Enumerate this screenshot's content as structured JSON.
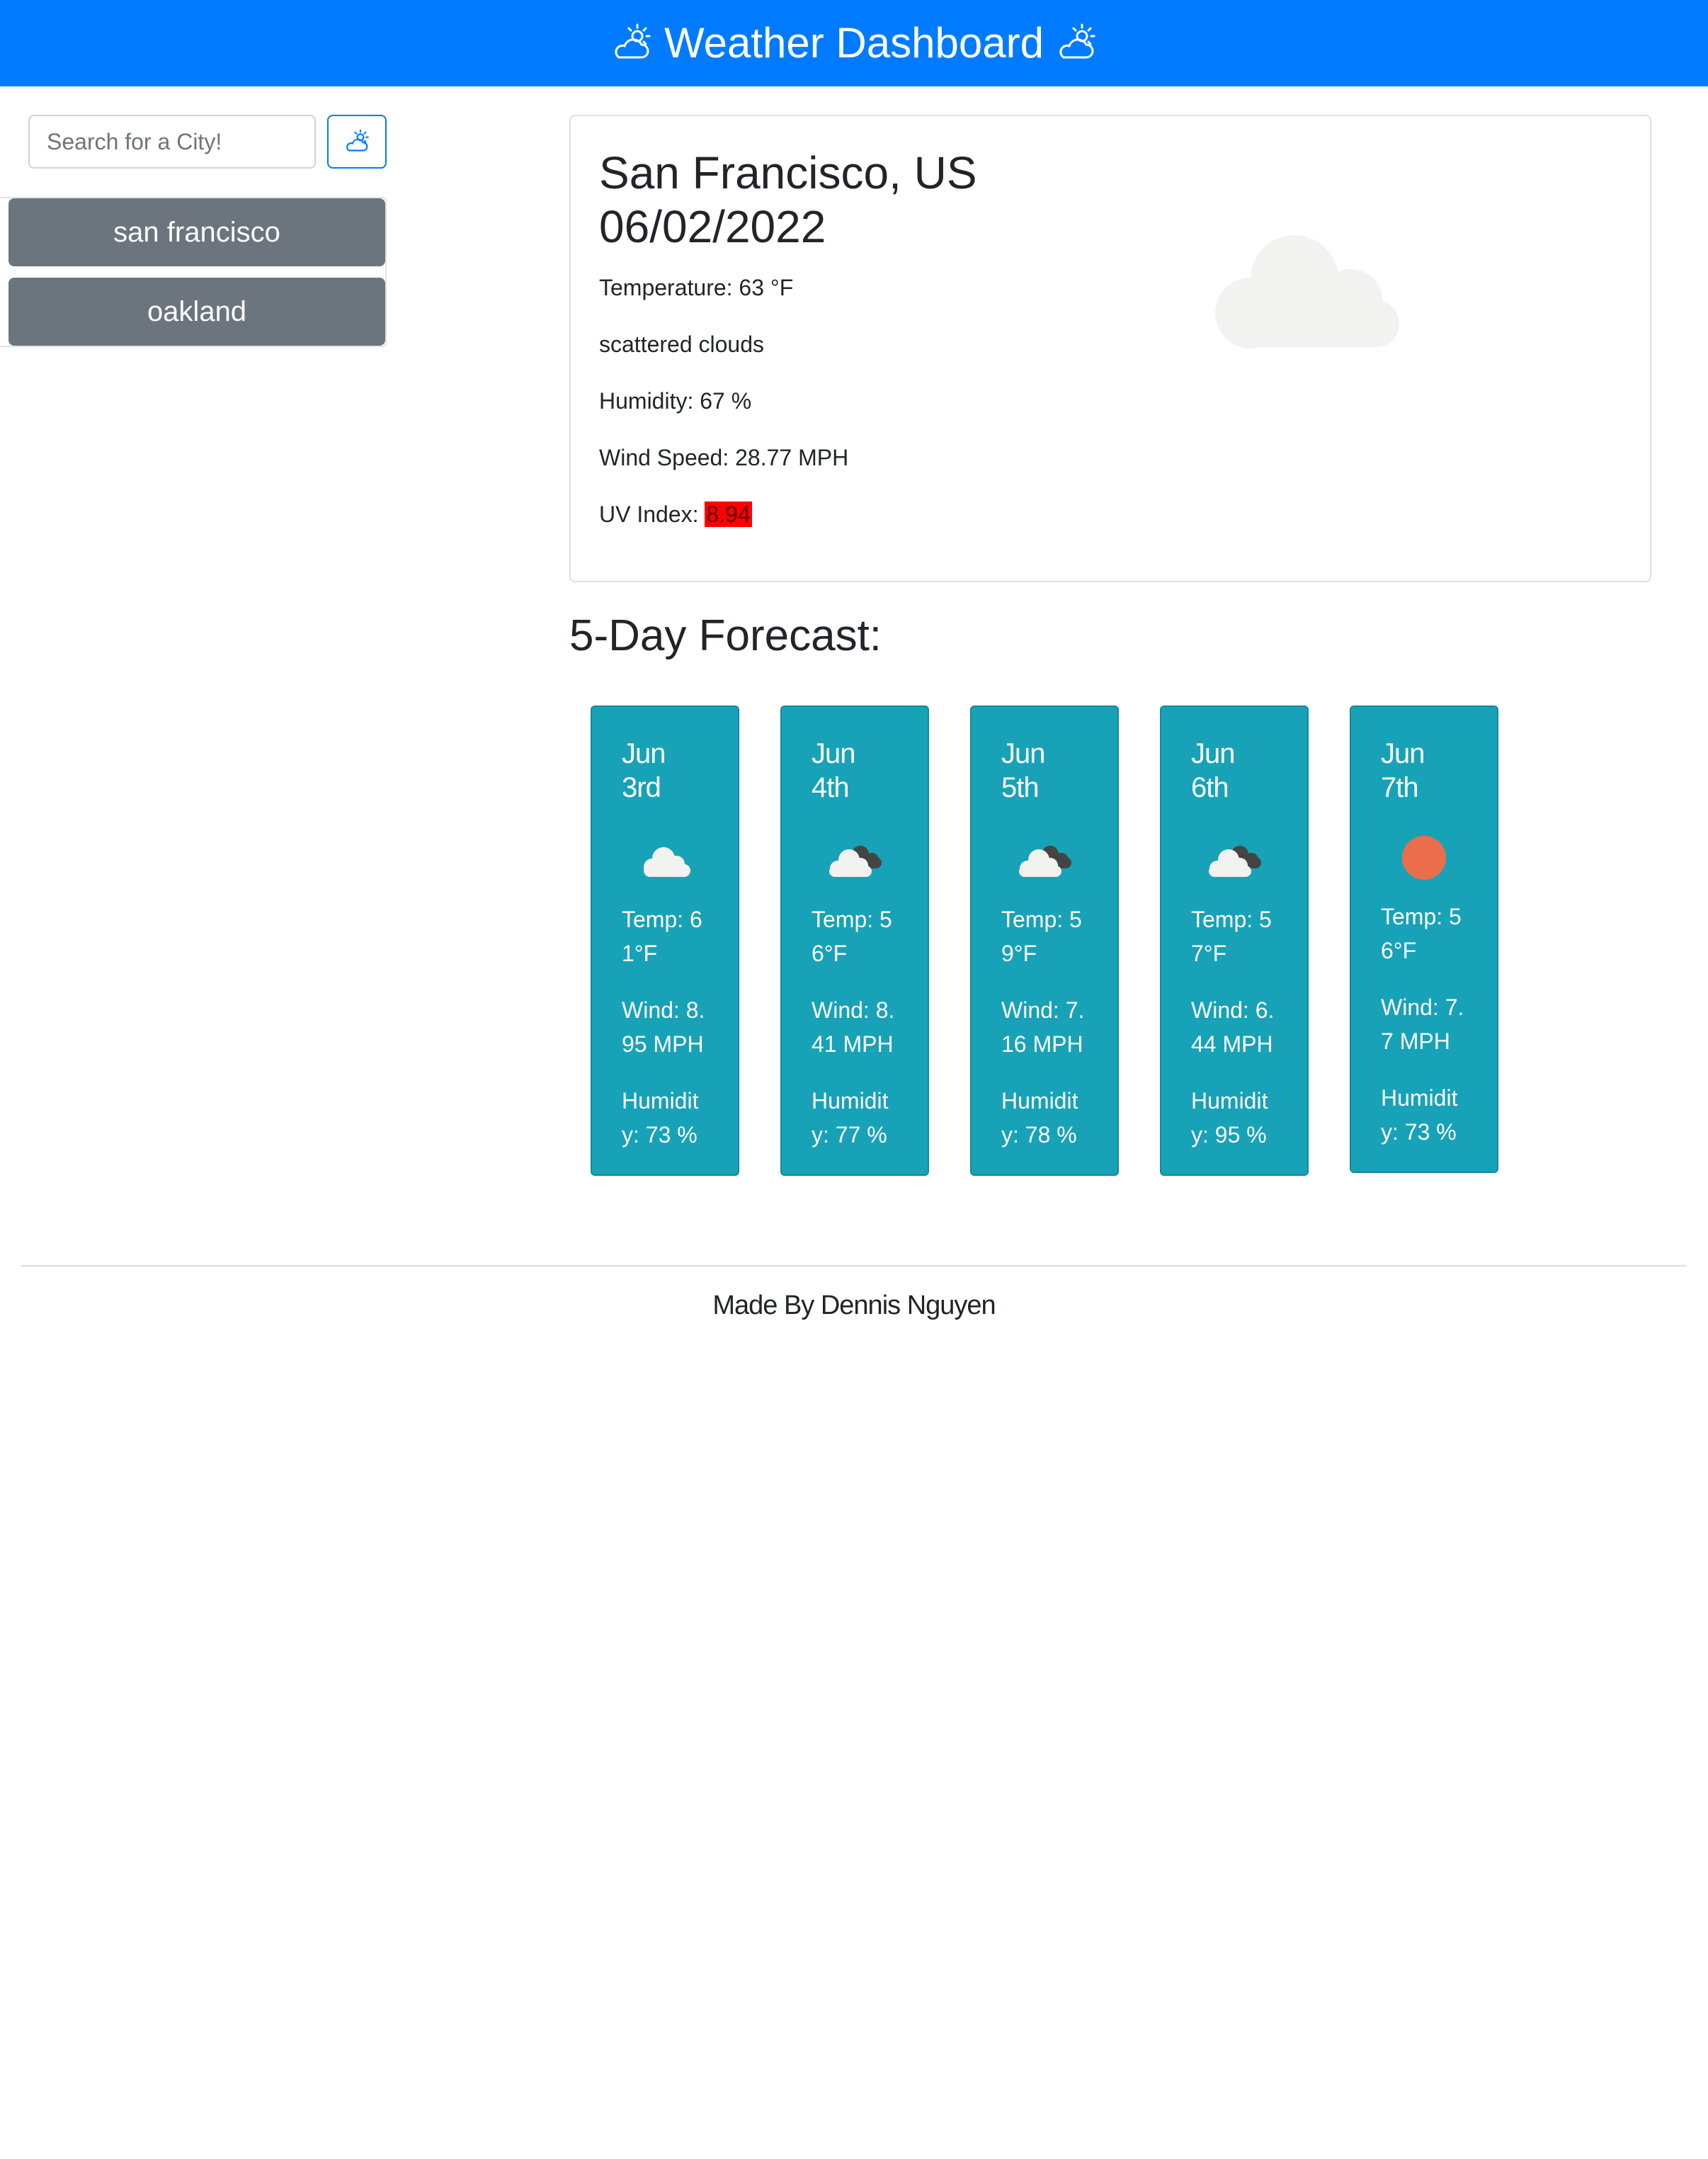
{
  "header": {
    "title": "Weather Dashboard",
    "left_icon": "partly-cloudy-icon",
    "right_icon": "partly-cloudy-icon",
    "background_color": "#007bff"
  },
  "search": {
    "placeholder": "Search for a City!",
    "button_icon": "partly-cloudy-icon"
  },
  "history": [
    {
      "label": "san francisco"
    },
    {
      "label": "oakland"
    }
  ],
  "current": {
    "city": "San Francisco, US",
    "date": "06/02/2022",
    "temperature": "Temperature: 63 °F",
    "description": "scattered clouds",
    "humidity": "Humidity: 67 %",
    "wind": "Wind Speed: 28.77 MPH",
    "uv_label": "UV Index: ",
    "uv_value": "8.94",
    "uv_color": "#ff0000",
    "icon": "cloud-icon"
  },
  "forecast": {
    "title": "5-Day Forecast:",
    "card_color": "#17a2b8",
    "days": [
      {
        "date": "Jun 3rd",
        "icon": "cloud-icon",
        "temp": "Temp: 61°F",
        "wind": "Wind: 8.95 MPH",
        "humidity": "Humidity: 73 %"
      },
      {
        "date": "Jun 4th",
        "icon": "broken-clouds-icon",
        "temp": "Temp: 56°F",
        "wind": "Wind: 8.41 MPH",
        "humidity": "Humidity: 77 %"
      },
      {
        "date": "Jun 5th",
        "icon": "broken-clouds-icon",
        "temp": "Temp: 59°F",
        "wind": "Wind: 7.16 MPH",
        "humidity": "Humidity: 78 %"
      },
      {
        "date": "Jun 6th",
        "icon": "broken-clouds-icon",
        "temp": "Temp: 57°F",
        "wind": "Wind: 6.44 MPH",
        "humidity": "Humidity: 95 %"
      },
      {
        "date": "Jun 7th",
        "icon": "clear-sun-icon",
        "temp": "Temp: 56°F",
        "wind": "Wind: 7.7 MPH",
        "humidity": "Humidity: 73 %"
      }
    ]
  },
  "footer": {
    "text": "Made By Dennis Nguyen"
  }
}
